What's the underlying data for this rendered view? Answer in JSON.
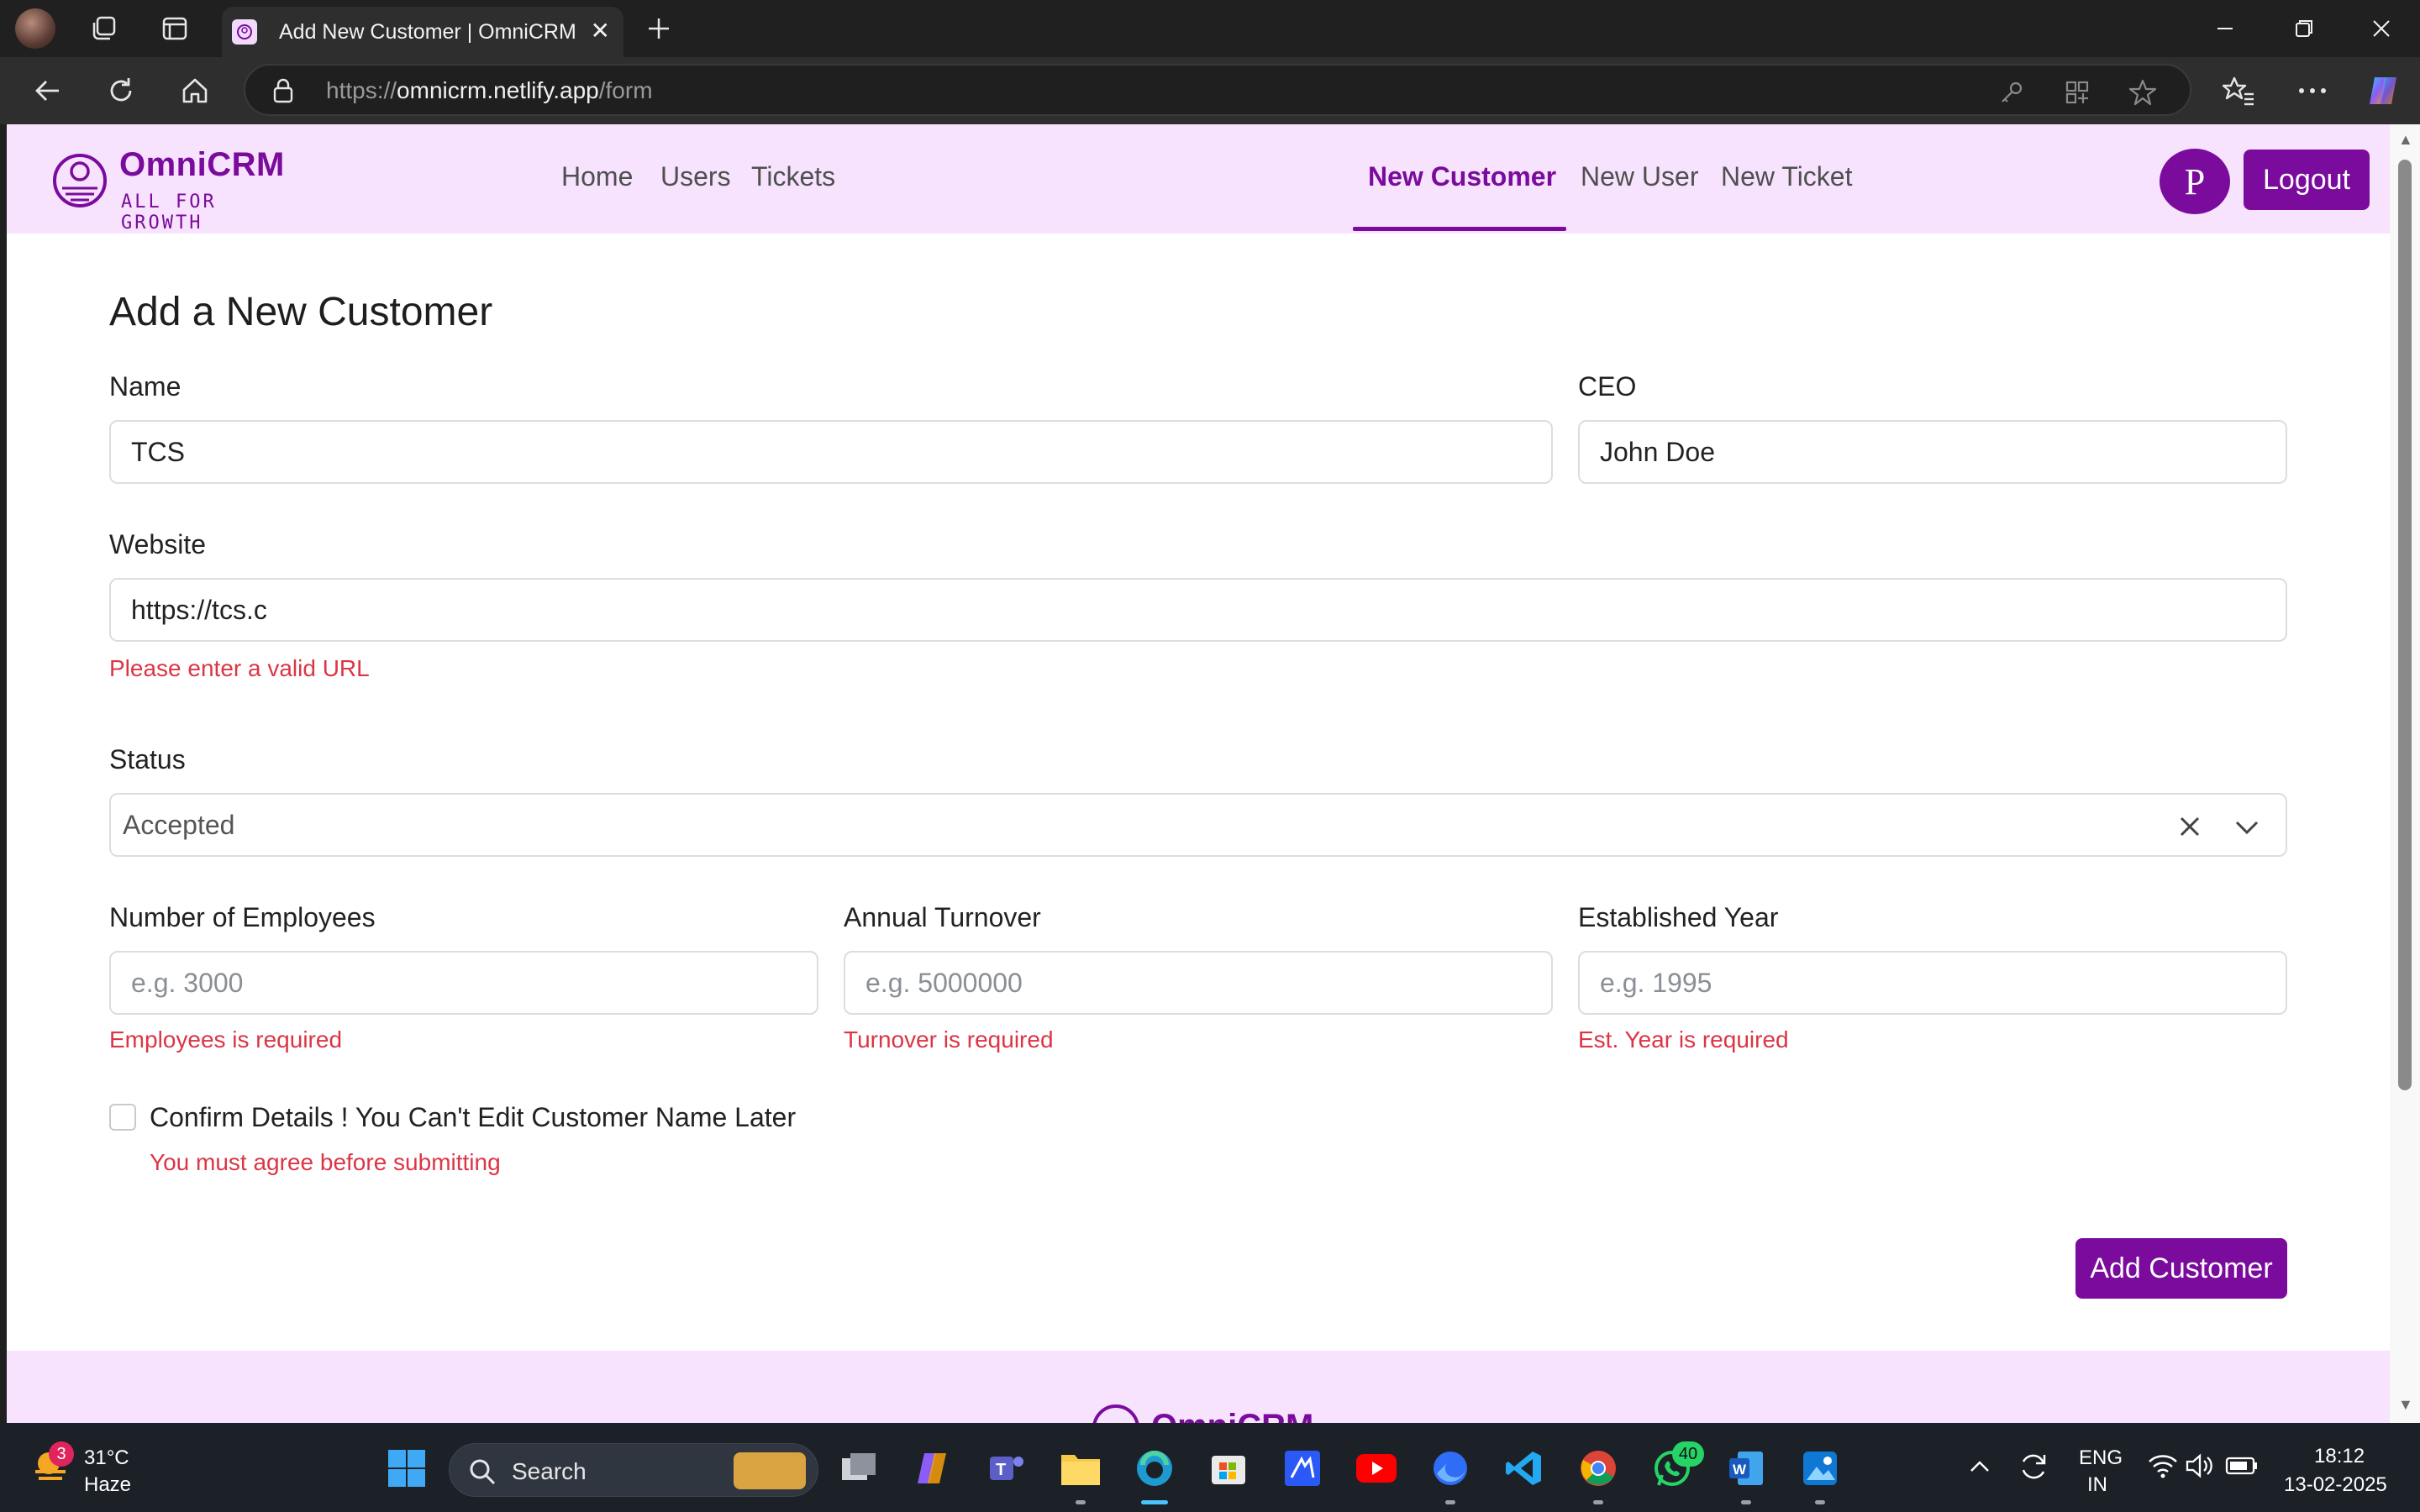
{
  "browser": {
    "tab_title": "Add New Customer | OmniCRM",
    "url_scheme": "https://",
    "url_host": "omnicrm.netlify.app",
    "url_path": "/form"
  },
  "navbar": {
    "logo_name": "OmniCRM",
    "logo_tagline": "ALL FOR GROWTH",
    "links": [
      "Home",
      "Users",
      "Tickets"
    ],
    "create_links": [
      "New Customer",
      "New User",
      "New Ticket"
    ],
    "active_link": "New Customer",
    "avatar_initial": "P",
    "logout_label": "Logout"
  },
  "form": {
    "title": "Add a New Customer",
    "name": {
      "label": "Name",
      "value": "TCS"
    },
    "ceo": {
      "label": "CEO",
      "value": "John Doe"
    },
    "website": {
      "label": "Website",
      "value": "https://tcs.c",
      "error": "Please enter a valid URL"
    },
    "status": {
      "label": "Status",
      "value": "Accepted"
    },
    "employees": {
      "label": "Number of Employees",
      "placeholder": "e.g. 3000",
      "error": "Employees is required"
    },
    "turnover": {
      "label": "Annual Turnover",
      "placeholder": "e.g. 5000000",
      "error": "Turnover is required"
    },
    "established": {
      "label": "Established Year",
      "placeholder": "e.g. 1995",
      "error": "Est. Year is required"
    },
    "confirm": {
      "label": "Confirm Details ! You Can't Edit Customer Name Later",
      "error": "You must agree before submitting",
      "checked": false
    },
    "submit_label": "Add Customer"
  },
  "footer": {
    "logo_name": "OmniCRM"
  },
  "taskbar": {
    "weather_badge": "3",
    "temperature": "31°C",
    "condition": "Haze",
    "search_label": "Search",
    "whatsapp_badge": "40",
    "language_line1": "ENG",
    "language_line2": "IN",
    "time": "18:12",
    "date": "13-02-2025"
  },
  "colors": {
    "brand": "#7a0b9c",
    "navbar_bg": "#f7e3fd",
    "error": "#dc3545"
  }
}
